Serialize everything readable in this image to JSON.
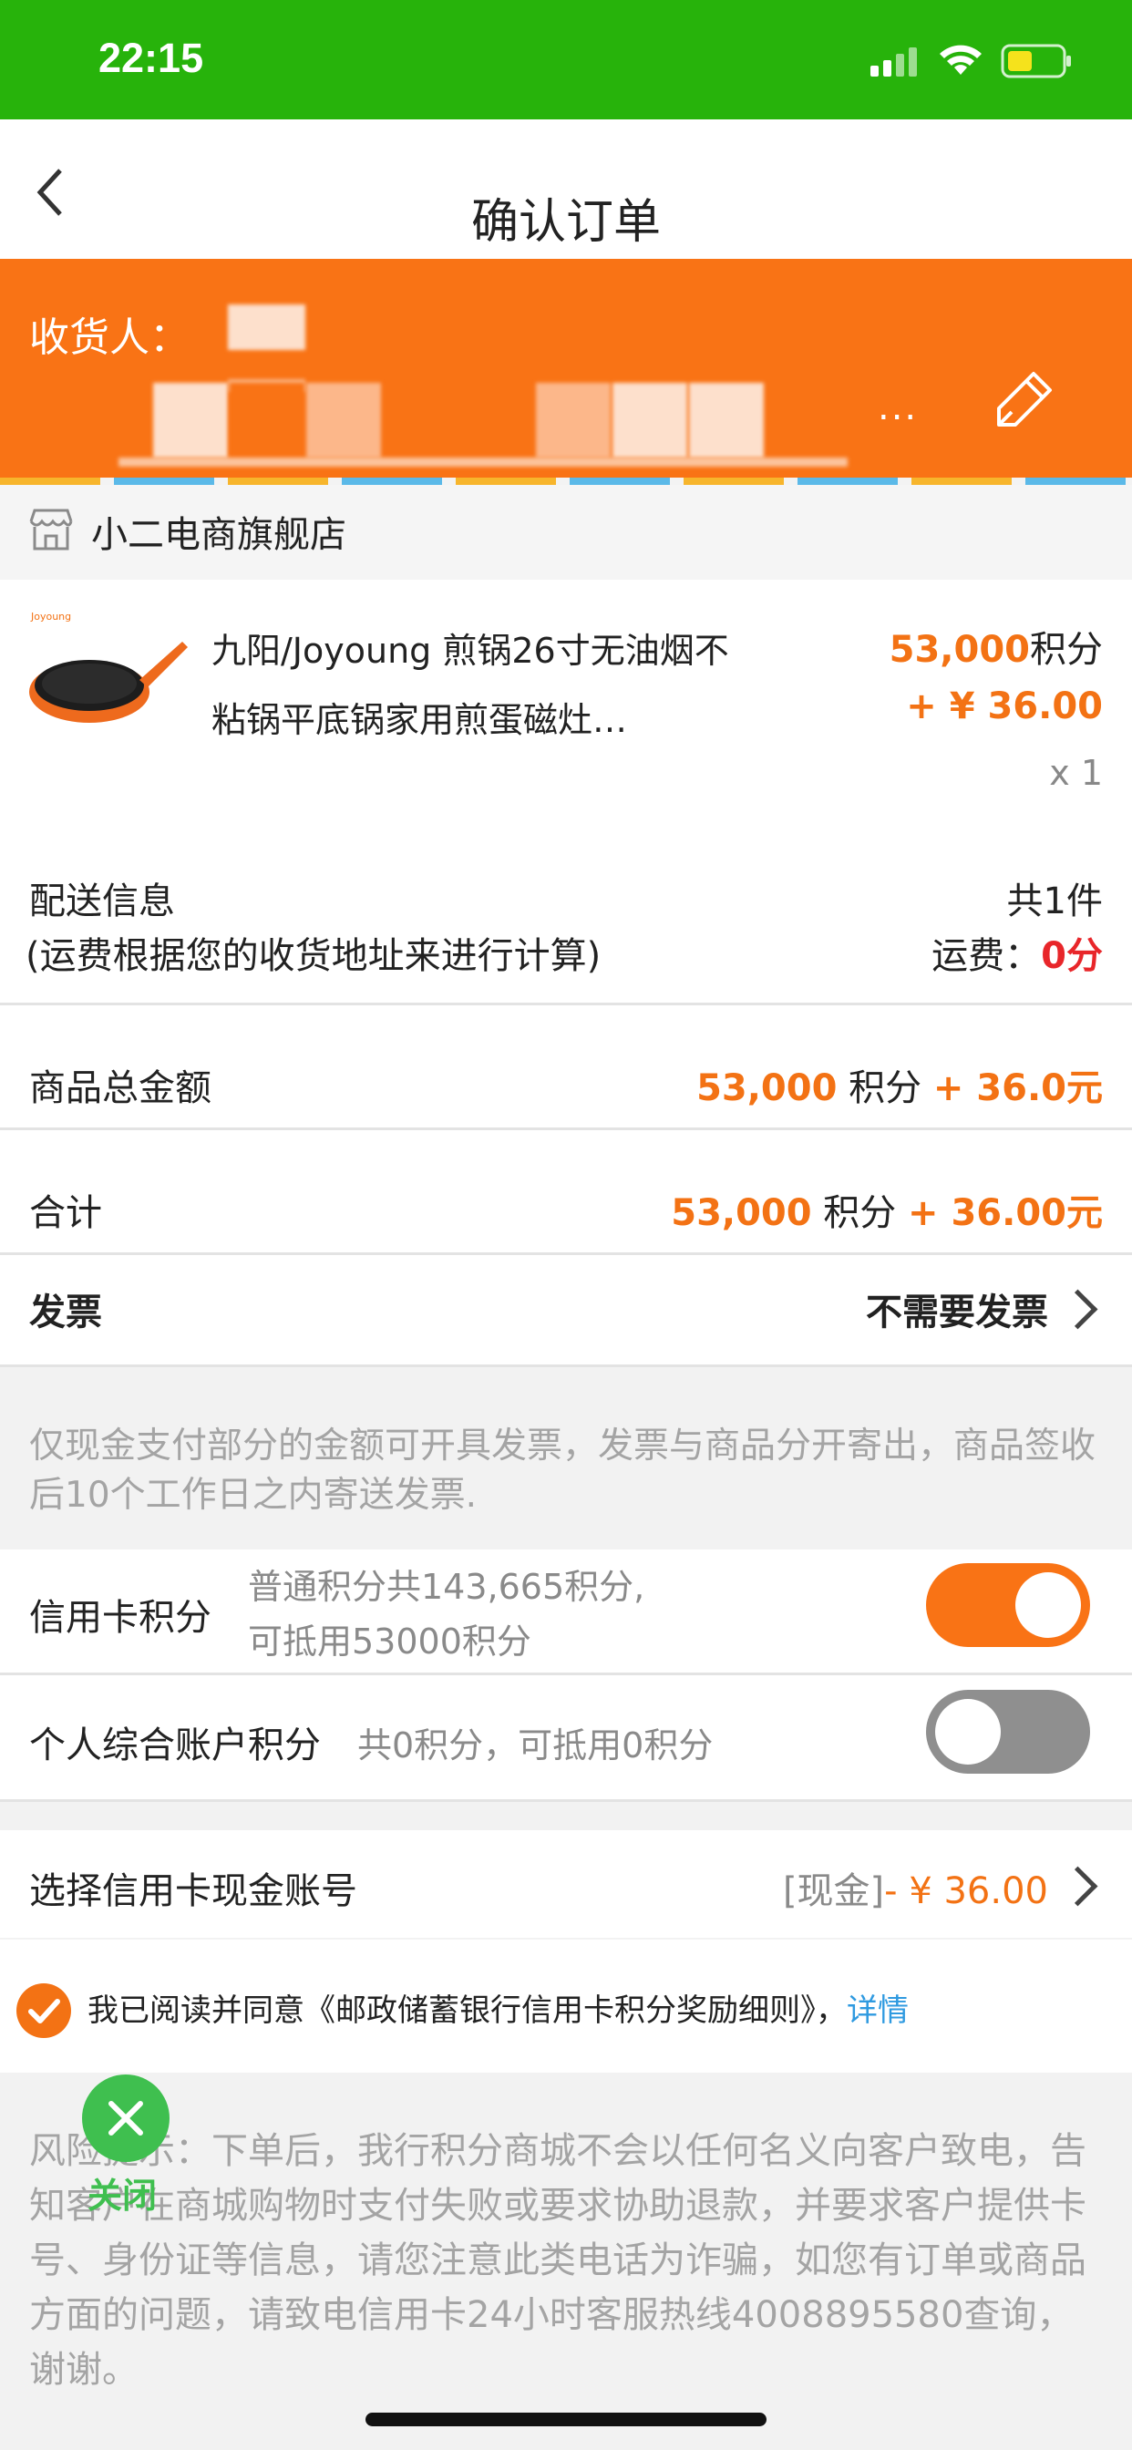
{
  "status_bar": {
    "time": "22:15"
  },
  "nav": {
    "title": "确认订单"
  },
  "address": {
    "recipient_label": "收货人：",
    "ellipsis": "..."
  },
  "store": {
    "name": "小二电商旗舰店"
  },
  "product": {
    "title": "九阳/Joyoung 煎锅26寸无油烟不粘锅平底锅家用煎蛋磁灶…",
    "points": "53,000",
    "points_unit": "积分",
    "price": "+ ¥ 36.00",
    "qty": "x 1"
  },
  "delivery": {
    "label": "配送信息",
    "note": "(运费根据您的收货地址来进行计算)",
    "count": "共1件",
    "fee_label": "运费：",
    "fee_value": "0分"
  },
  "subtotal": {
    "label": "商品总金额",
    "points": "53,000",
    "points_unit": " 积分 ",
    "cash": "+ 36.0元"
  },
  "total": {
    "label": "合计",
    "points": "53,000",
    "points_unit": " 积分 ",
    "cash": "+ 36.00元"
  },
  "invoice": {
    "label": "发票",
    "value": "不需要发票",
    "note": "仅现金支付部分的金额可开具发票，发票与商品分开寄出，商品签收后10个工作日之内寄送发票."
  },
  "credit_points": {
    "label": "信用卡积分",
    "desc_line1": "普通积分共143,665积分,",
    "desc_line2": "可抵用53000积分",
    "enabled": true
  },
  "personal_points": {
    "label": "个人综合账户积分",
    "desc": "共0积分，可抵用0积分",
    "enabled": false
  },
  "cash_account": {
    "label": "选择信用卡现金账号",
    "prefix": "[现金]",
    "value": "- ¥ 36.00"
  },
  "agreement": {
    "text": "我已阅读并同意《邮政储蓄银行信用卡积分奖励细则》，",
    "link": "详情"
  },
  "close_float": {
    "label": "关闭"
  },
  "risk_note": "风险提示：下单后，我行积分商城不会以任何名义向客户致电，告知客户在商城购物时支付失败或要求协助退款，并要求客户提供卡号、身份证等信息，请您注意此类电话为诈骗，如您有订单或商品方面的问题，请致电信用卡24小时客服热线4008895580查询，谢谢。",
  "colors": {
    "status_green": "#27b30b",
    "accent_orange": "#f97315",
    "toggle_off": "#8f8f8f",
    "link_blue": "#2f9ae0"
  }
}
